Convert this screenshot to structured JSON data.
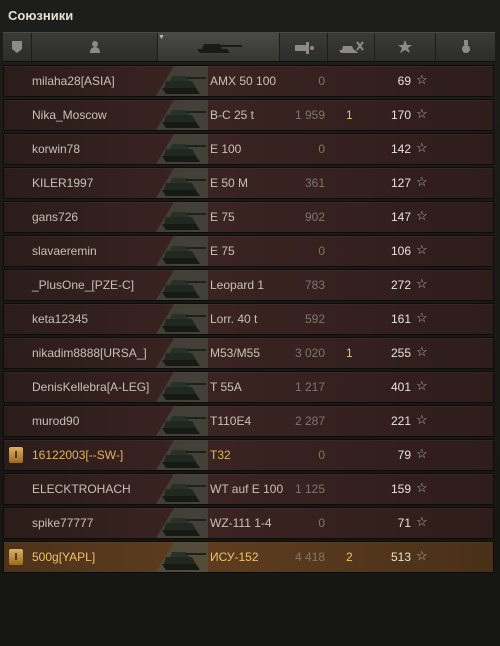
{
  "panel": {
    "title": "Союзники"
  },
  "header": {
    "columns": [
      {
        "icon": "platoon-icon"
      },
      {
        "icon": "player-icon"
      },
      {
        "icon": "tank-icon",
        "sorted": true
      },
      {
        "icon": "damage-icon"
      },
      {
        "icon": "kills-icon"
      },
      {
        "icon": "star-icon"
      },
      {
        "icon": "medal-icon"
      }
    ]
  },
  "colors": {
    "row_bg": "#3b2422",
    "self_bg": "#5e3d1f",
    "platoon_badge": "#e0b060",
    "kills": "#e8c066"
  },
  "rows": [
    {
      "name": "milaha28[ASIA]",
      "vehicle": "AMX 50 100",
      "damage": "0",
      "kills": "",
      "xp": "69",
      "platoon": "",
      "self": false
    },
    {
      "name": "Nika_Moscow",
      "vehicle": "B-C 25 t",
      "damage": "1 959",
      "kills": "1",
      "xp": "170",
      "platoon": "",
      "self": false
    },
    {
      "name": "korwin78",
      "vehicle": "E 100",
      "damage": "0",
      "kills": "",
      "xp": "142",
      "platoon": "",
      "self": false
    },
    {
      "name": "KILER1997",
      "vehicle": "E 50 M",
      "damage": "361",
      "kills": "",
      "xp": "127",
      "platoon": "",
      "self": false
    },
    {
      "name": "gans726",
      "vehicle": "E 75",
      "damage": "902",
      "kills": "",
      "xp": "147",
      "platoon": "",
      "self": false
    },
    {
      "name": "slavaeremin",
      "vehicle": "E 75",
      "damage": "0",
      "kills": "",
      "xp": "106",
      "platoon": "",
      "self": false
    },
    {
      "name": "_PlusOne_[PZE-C]",
      "vehicle": "Leopard 1",
      "damage": "783",
      "kills": "",
      "xp": "272",
      "platoon": "",
      "self": false
    },
    {
      "name": "keta12345",
      "vehicle": "Lorr. 40 t",
      "damage": "592",
      "kills": "",
      "xp": "161",
      "platoon": "",
      "self": false
    },
    {
      "name": "nikadim8888[URSA_]",
      "vehicle": "M53/M55",
      "damage": "3 020",
      "kills": "1",
      "xp": "255",
      "platoon": "",
      "self": false
    },
    {
      "name": "DenisKellebra[A-LEG]",
      "vehicle": "T 55A",
      "damage": "1 217",
      "kills": "",
      "xp": "401",
      "platoon": "",
      "self": false
    },
    {
      "name": "murod90",
      "vehicle": "T110E4",
      "damage": "2 287",
      "kills": "",
      "xp": "221",
      "platoon": "",
      "self": false
    },
    {
      "name": "16122003[--SW-]",
      "vehicle": "T32",
      "damage": "0",
      "kills": "",
      "xp": "79",
      "platoon": "I",
      "self": false
    },
    {
      "name": "ELECKTROHACH",
      "vehicle": "WT auf E 100",
      "damage": "1 125",
      "kills": "",
      "xp": "159",
      "platoon": "",
      "self": false
    },
    {
      "name": "spike77777",
      "vehicle": "WZ-111 1-4",
      "damage": "0",
      "kills": "",
      "xp": "71",
      "platoon": "",
      "self": false
    },
    {
      "name": "500g[YAPL]",
      "vehicle": "ИСУ-152",
      "damage": "4 418",
      "kills": "2",
      "xp": "513",
      "platoon": "I",
      "self": true
    }
  ]
}
